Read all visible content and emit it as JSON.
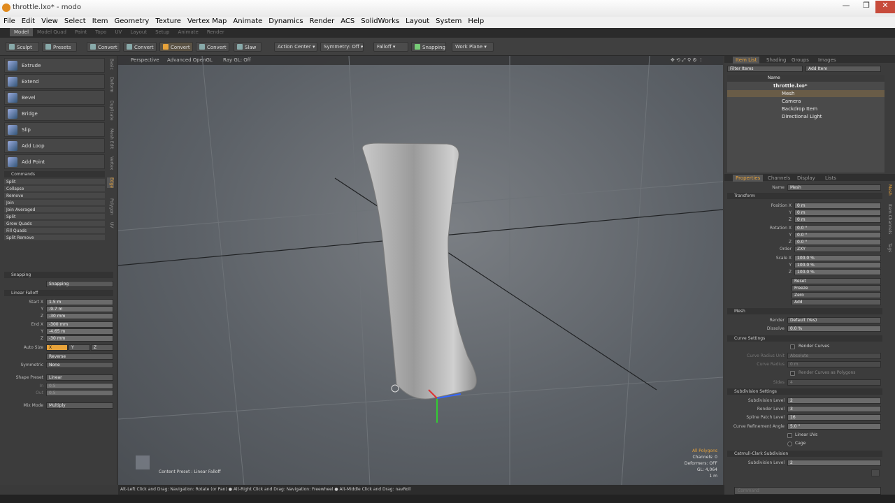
{
  "window": {
    "title": "throttle.lxo* - modo",
    "minimize": "—",
    "maximize": "❐",
    "close": "✕"
  },
  "menu": [
    "File",
    "Edit",
    "View",
    "Select",
    "Item",
    "Geometry",
    "Texture",
    "Vertex Map",
    "Animate",
    "Dynamics",
    "Render",
    "ACS",
    "SolidWorks",
    "Layout",
    "System",
    "Help"
  ],
  "layout_tabs": [
    "Model",
    "Model Quad",
    "Paint",
    "Topo",
    "UV",
    "Layout",
    "Setup",
    "Animate",
    "Render"
  ],
  "toolbar": {
    "sculpt": "Sculpt",
    "presets": "Presets",
    "convert": [
      "Convert",
      "Convert",
      "Convert",
      "Convert"
    ],
    "sliceslice": "Slaw",
    "action_center": "Action Center",
    "symmetry": "Symmetry: Off",
    "falloff": "Falloff",
    "snapping": "Snapping",
    "workplane": "Work Plane"
  },
  "tools": [
    "Extrude",
    "Extend",
    "Bevel",
    "Bridge",
    "Slip",
    "Add Loop",
    "Add Point"
  ],
  "side_vtabs": [
    "Basic",
    "Deform",
    "Duplicate",
    "Mesh Edit",
    "Vertex",
    "Edge",
    "Polygon",
    "UV"
  ],
  "commands": {
    "header": "Commands",
    "items": [
      "Split",
      "Collapse",
      "Remove",
      "Join",
      "Join Averaged",
      "Split",
      "Grow Quads",
      "Fill Quads",
      "Split Remove"
    ]
  },
  "snapping": {
    "header": "Snapping",
    "value": "Snapping"
  },
  "linear_falloff": {
    "header": "Linear Falloff",
    "start_label": "Start X",
    "start": [
      "1.5 m",
      "-9.7 m",
      "-30 mm"
    ],
    "end_label": "End X",
    "end": [
      "-300 mm",
      "-4.65 m",
      "-30 mm"
    ],
    "yz_labels": [
      "Y",
      "Z"
    ],
    "auto_size_label": "Auto Size",
    "auto_size": [
      "X",
      "Y",
      "Z"
    ],
    "reverse": "Reverse",
    "symmetric_label": "Symmetric",
    "symmetric": "None",
    "shape_label": "Shape Preset",
    "shape": "Linear",
    "in_label": "In",
    "out_label": "Out",
    "in": "0.5",
    "out": "0.5",
    "mix_label": "Mix Mode",
    "mix": "Multiply"
  },
  "viewport": {
    "tabs": [
      "Perspective",
      "Advanced OpenGL",
      "Ray GL: Off"
    ],
    "content_preset": "Content Preset : Linear Falloff",
    "hud": [
      "All Polygons",
      "Channels: 0",
      "Deformers: OFF",
      "GL: 4,064",
      "1 m"
    ]
  },
  "status": "Alt-Left Click and Drag: Navigation: Rotate (or Pan) ● Alt-Right Click and Drag: Navigation: Freewheel ● Alt-Middle Click and Drag: navRoll",
  "item_list": {
    "tabs": [
      "Item List",
      "Shading",
      "Groups",
      "Images"
    ],
    "filter": "Filter Items",
    "add": "Add Item",
    "name_col": "Name",
    "items": [
      "throttle.lxo*",
      "Mesh",
      "Camera",
      "Backdrop Item",
      "Directional Light"
    ]
  },
  "properties": {
    "tabs": [
      "Properties",
      "Channels",
      "Display",
      "Lists"
    ],
    "side_tabs": [
      "Mesh",
      "Item Channels",
      "Tags"
    ],
    "name_label": "Name",
    "name": "Mesh",
    "transform_header": "Transform",
    "position_label": "Position X",
    "position": [
      "0 m",
      "0 m",
      "0 m"
    ],
    "rotation_label": "Rotation X",
    "rotation": [
      "0.0 °",
      "0.0 °",
      "0.0 °"
    ],
    "order_label": "Order",
    "order": "ZXY",
    "scale_label": "Scale X",
    "scale": [
      "100.0 %",
      "100.0 %",
      "100.0 %"
    ],
    "yz_labels": [
      "Y",
      "Z"
    ],
    "actions": [
      "Reset",
      "Freeze",
      "Zero",
      "Add"
    ],
    "mesh_header": "Mesh",
    "render_label": "Render",
    "render": "Default (Yes)",
    "dissolve_label": "Dissolve",
    "dissolve": "0.0 %",
    "curve_header": "Curve Settings",
    "render_curves": "Render Curves",
    "curve_radius_unit": "Curve Radius Unit",
    "curve_radius_unit_val": "Absolute",
    "curve_radius": "Curve Radius",
    "curve_radius_val": "0 m",
    "render_curve_poly": "Render Curves as Polygons",
    "sides_label": "Sides",
    "sides": "4",
    "subdiv_header": "Subdivision Settings",
    "subdiv_level_label": "Subdivision Level",
    "subdiv_level": "2",
    "render_level_label": "Render Level",
    "render_level": "3",
    "spline_label": "Spline Patch Level",
    "spline": "16",
    "curve_ref_label": "Curve Refinement Angle",
    "curve_ref": "5.0 °",
    "linear_uvs": "Linear UVs",
    "cage": "Cage",
    "catmull_header": "Catmull-Clark Subdivision",
    "cc_level_label": "Subdivision Level",
    "cc_level": "2"
  },
  "command_field": {
    "placeholder": "Command"
  },
  "colors": {
    "accent": "#e8a33a",
    "panel": "#3c3c3c",
    "viewport": "#6a6e73"
  }
}
